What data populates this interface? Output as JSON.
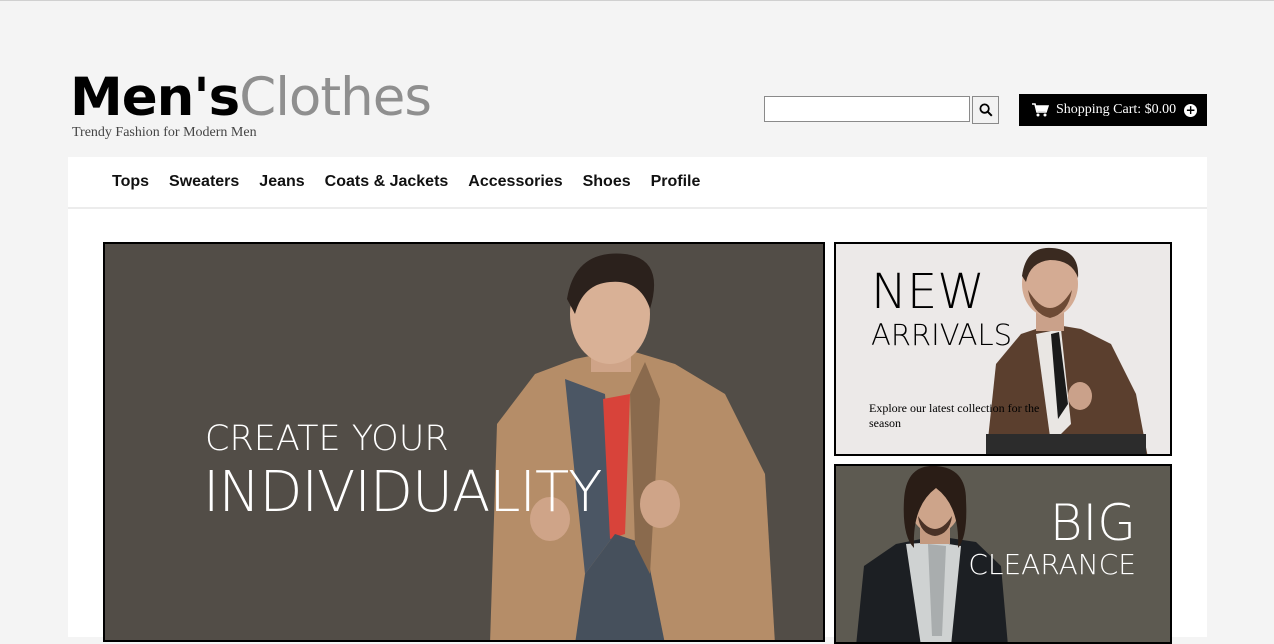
{
  "brand": {
    "name_bold": "Men's",
    "name_light": "Clothes",
    "tagline": "Trendy Fashion for Modern Men"
  },
  "search": {
    "value": "",
    "icon": "search-icon"
  },
  "cart": {
    "label": "Shopping Cart: $0.00",
    "icon": "shopping-cart-icon",
    "add_icon": "plus-circle-icon"
  },
  "nav": {
    "items": [
      {
        "label": "Tops"
      },
      {
        "label": "Sweaters"
      },
      {
        "label": "Jeans"
      },
      {
        "label": "Coats & Jackets"
      },
      {
        "label": "Accessories"
      },
      {
        "label": "Shoes"
      },
      {
        "label": "Profile"
      }
    ]
  },
  "hero": {
    "line1": "CREATE YOUR",
    "line2": "INDIVIDUALITY"
  },
  "promo_new": {
    "title": "NEW",
    "subtitle": "ARRIVALS",
    "description": "Explore our latest collection for the season"
  },
  "promo_clearance": {
    "title": "BIG",
    "subtitle": "CLEARANCE"
  },
  "colors": {
    "page_bg": "#f4f4f4",
    "hero_bg": "#524d47",
    "promo_new_bg": "#ece9e8",
    "promo_clear_bg": "#5d5a51",
    "cart_bg": "#000000",
    "logo_light": "#8f8f8f"
  }
}
